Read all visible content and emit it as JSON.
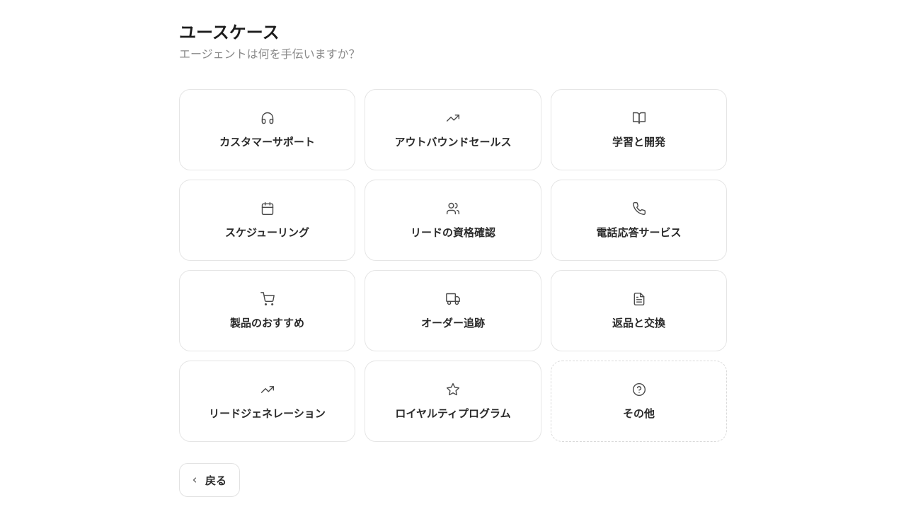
{
  "header": {
    "title": "ユースケース",
    "subtitle": "エージェントは何を手伝いますか？"
  },
  "use_cases": [
    {
      "label": "カスタマーサポート",
      "icon": "headphones-icon"
    },
    {
      "label": "アウトバウンドセールス",
      "icon": "trending-up-icon"
    },
    {
      "label": "学習と開発",
      "icon": "book-open-icon"
    },
    {
      "label": "スケジューリング",
      "icon": "calendar-icon"
    },
    {
      "label": "リードの資格確認",
      "icon": "users-icon"
    },
    {
      "label": "電話応答サービス",
      "icon": "phone-icon"
    },
    {
      "label": "製品のおすすめ",
      "icon": "shopping-cart-icon"
    },
    {
      "label": "オーダー追跡",
      "icon": "truck-icon"
    },
    {
      "label": "返品と交換",
      "icon": "file-text-icon"
    },
    {
      "label": "リードジェネレーション",
      "icon": "trending-up-icon"
    },
    {
      "label": "ロイヤルティプログラム",
      "icon": "star-icon"
    },
    {
      "label": "その他",
      "icon": "help-circle-icon"
    }
  ],
  "footer": {
    "back_label": "戻る"
  }
}
